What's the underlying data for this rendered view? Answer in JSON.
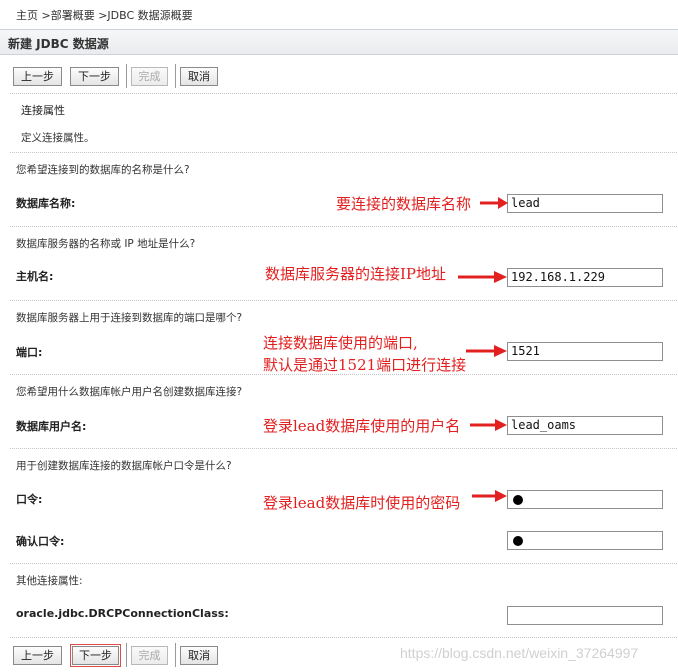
{
  "breadcrumb": "主页 >部署概要 >JDBC 数据源概要",
  "page_title": "新建 JDBC 数据源",
  "toolbar": {
    "back": "上一步",
    "next": "下一步",
    "finish": "完成",
    "cancel": "取消"
  },
  "section": {
    "title": "连接属性",
    "description": "定义连接属性。"
  },
  "fields": {
    "database_name": {
      "question": "您希望连接到的数据库的名称是什么?",
      "label": "数据库名称:",
      "value": "lead"
    },
    "host_name": {
      "question": "数据库服务器的名称或 IP 地址是什么?",
      "label": "主机名:",
      "value": "192.168.1.229"
    },
    "port": {
      "question": "数据库服务器上用于连接到数据库的端口是哪个?",
      "label": "端口:",
      "value": "1521"
    },
    "db_user": {
      "question": "您希望用什么数据库帐户用户名创建数据库连接?",
      "label": "数据库用户名:",
      "value": "lead_oams"
    },
    "password": {
      "question": "用于创建数据库连接的数据库帐户口令是什么?",
      "label": "口令:",
      "value": "●"
    },
    "confirm_password": {
      "label": "确认口令:",
      "value": "●"
    },
    "other": {
      "question": "其他连接属性:",
      "label": "oracle.jdbc.DRCPConnectionClass:",
      "value": ""
    }
  },
  "annotations": {
    "database_name": "要连接的数据库名称",
    "host_name": "数据库服务器的连接IP地址",
    "port_line1": "连接数据库使用的端口,",
    "port_line2": "默认是通过1521端口进行连接",
    "db_user": "登录lead数据库使用的用户名",
    "password": "登录lead数据库时使用的密码"
  },
  "watermark": "https://blog.csdn.net/weixin_37264997",
  "colors": {
    "annotation": "#e32020",
    "header_bg": "#eceef1"
  }
}
